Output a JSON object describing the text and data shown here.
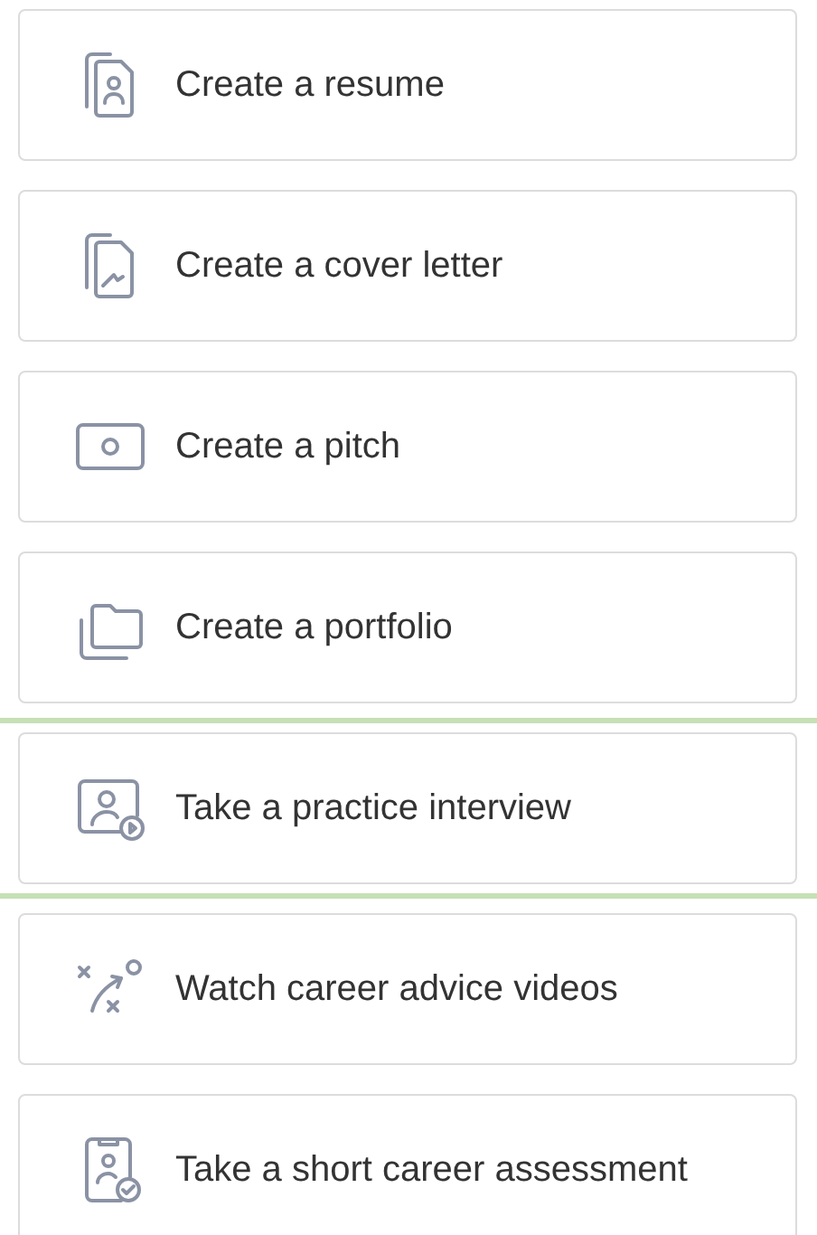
{
  "items": [
    {
      "kind": "resume",
      "label": "Create a resume",
      "selected": false
    },
    {
      "kind": "cover-letter",
      "label": "Create a cover letter",
      "selected": false
    },
    {
      "kind": "pitch",
      "label": "Create a pitch",
      "selected": false
    },
    {
      "kind": "portfolio",
      "label": "Create a portfolio",
      "selected": false
    },
    {
      "kind": "interview",
      "label": "Take a practice interview",
      "selected": true
    },
    {
      "kind": "videos",
      "label": "Watch career advice videos",
      "selected": false
    },
    {
      "kind": "assessment",
      "label": "Take a short career assessment",
      "selected": false
    }
  ]
}
